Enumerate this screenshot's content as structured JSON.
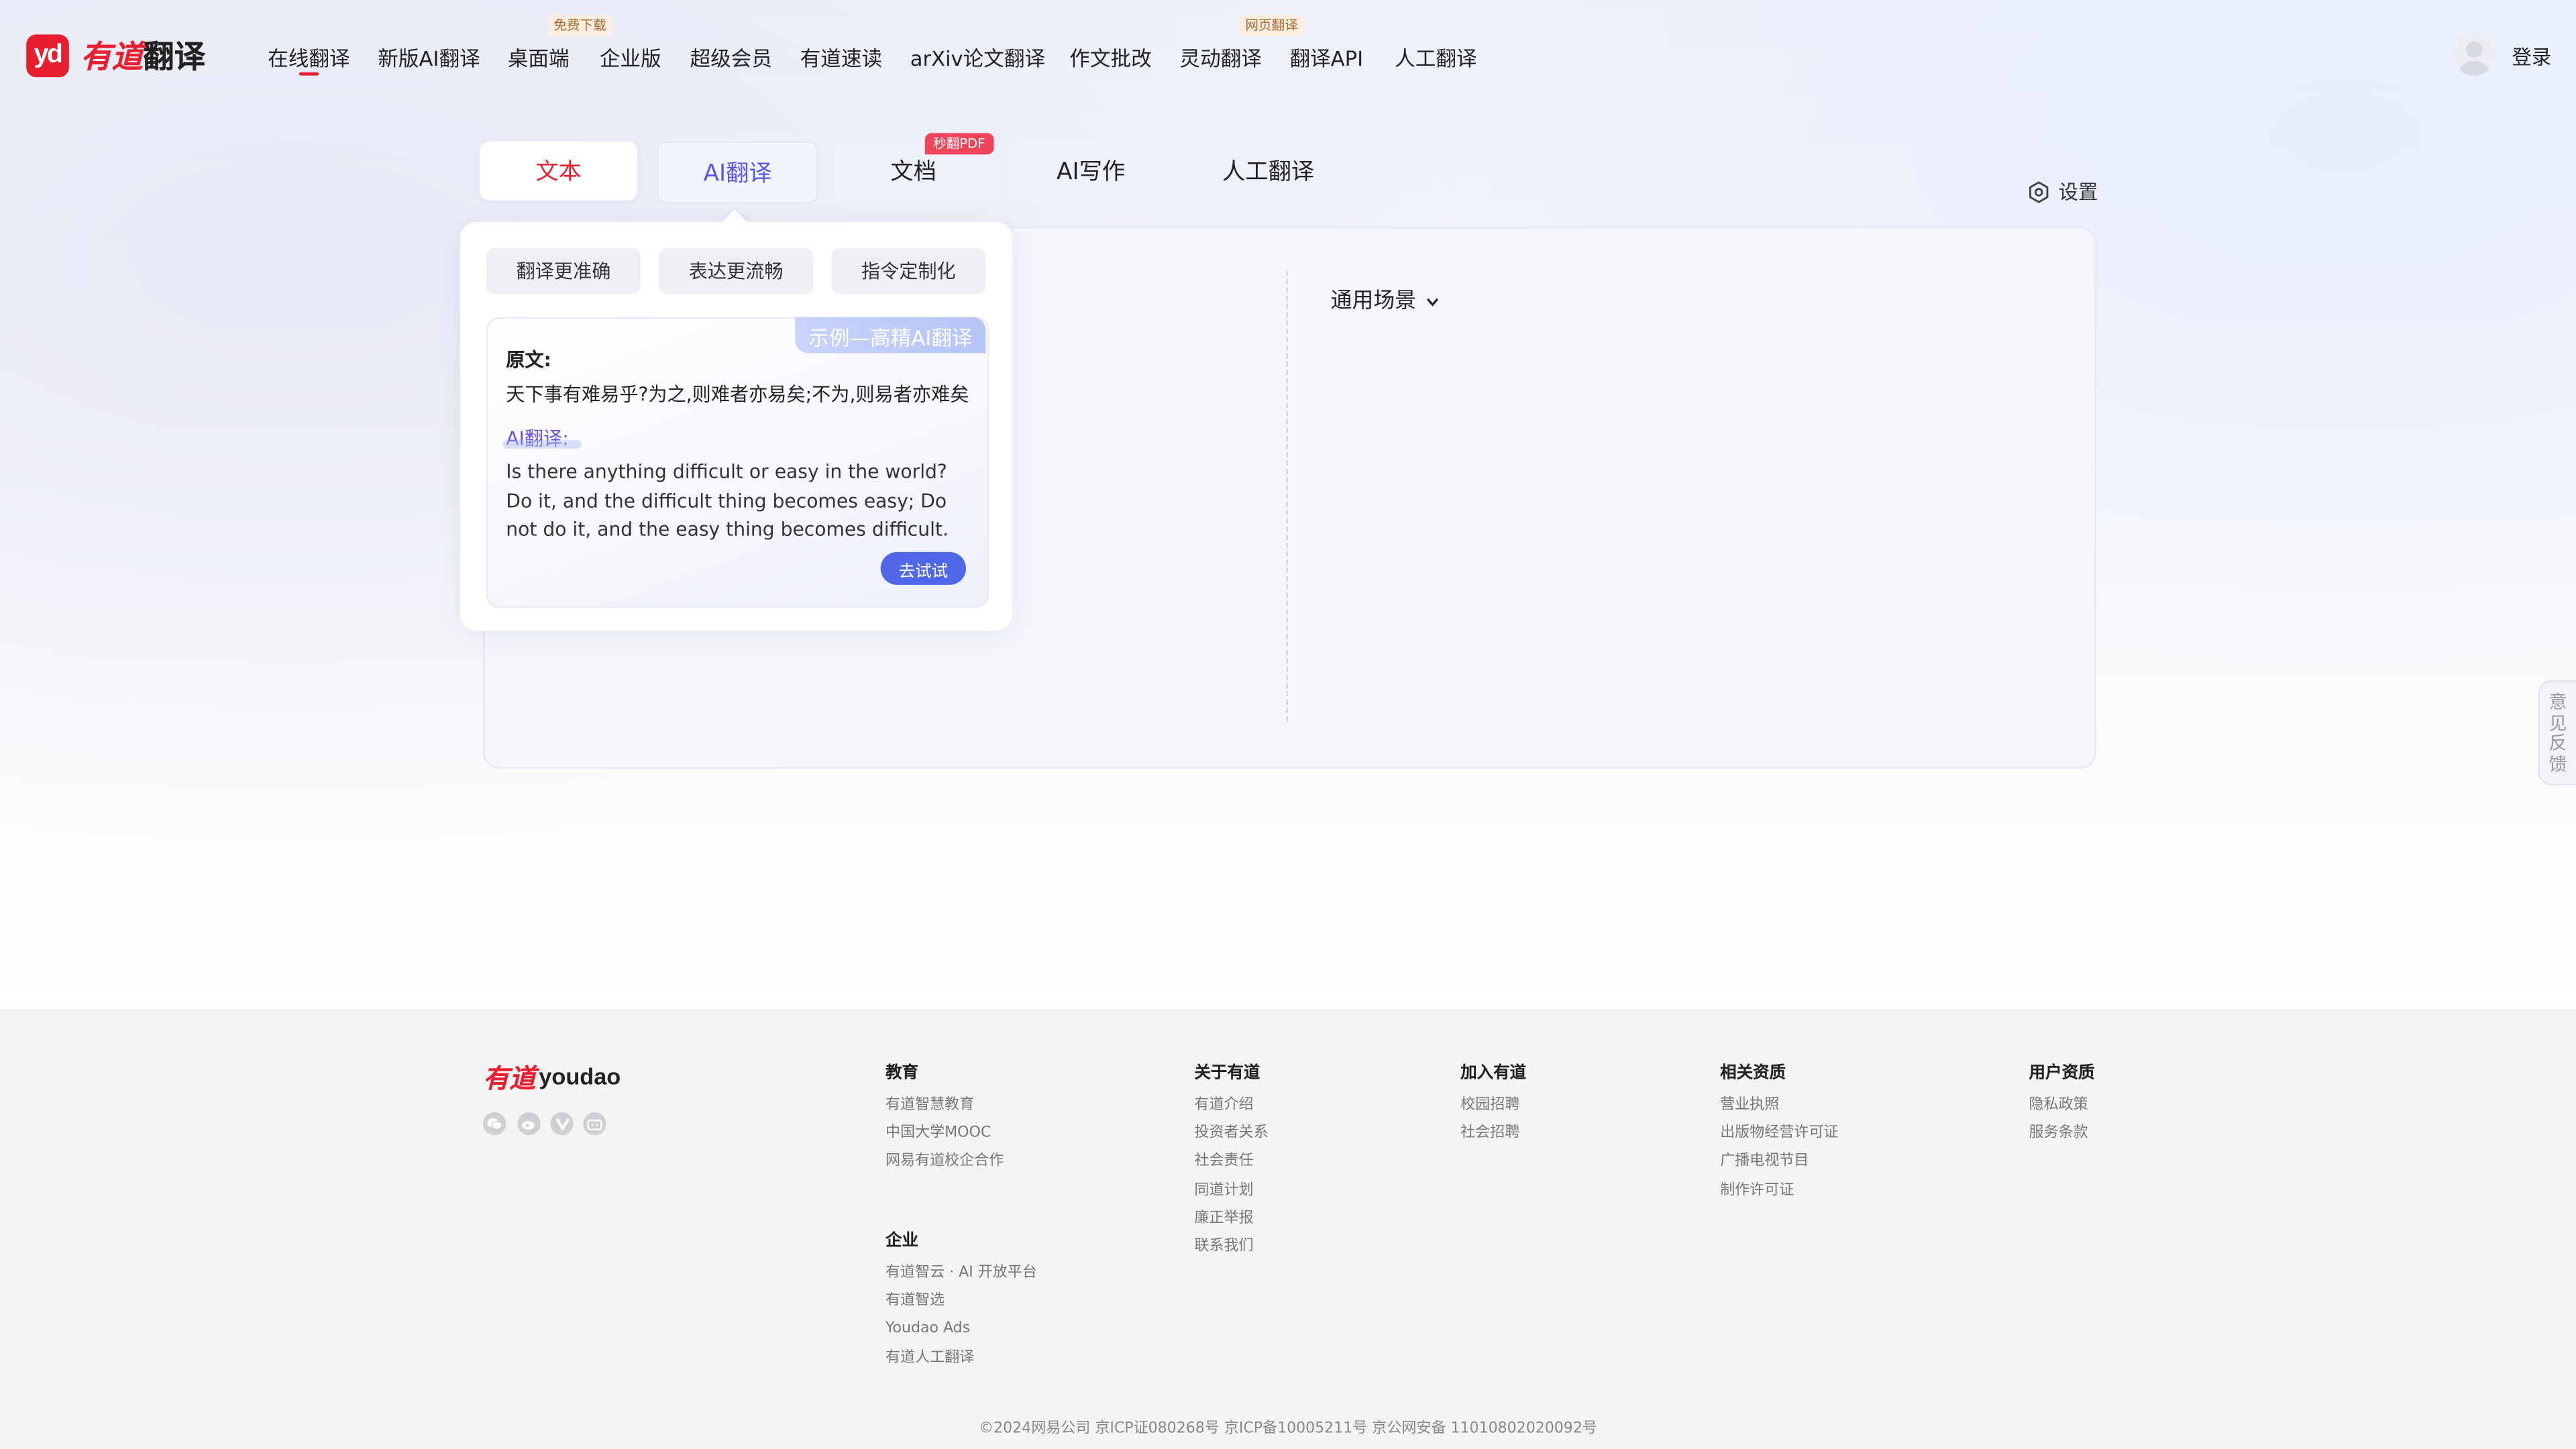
{
  "brand": {
    "logo_mark": "yd",
    "name_red": "有道",
    "name_dark": "翻译",
    "accent_color": "#e81f2e"
  },
  "nav": {
    "items": [
      {
        "label": "在线翻译"
      },
      {
        "label": "新版AI翻译"
      },
      {
        "label": "桌面端",
        "tag": "免费下载"
      },
      {
        "label": "企业版"
      },
      {
        "label": "超级会员"
      },
      {
        "label": "有道速读"
      },
      {
        "label": "arXiv论文翻译"
      },
      {
        "label": "作文批改"
      },
      {
        "label": "灵动翻译",
        "tag": "网页翻译"
      },
      {
        "label": "翻译API"
      },
      {
        "label": "人工翻译"
      }
    ],
    "active": "在线翻译",
    "login": "登录"
  },
  "tabs": [
    {
      "label": "文本"
    },
    {
      "label": "AI翻译"
    },
    {
      "label": "文档",
      "badge": "秒翻PDF"
    },
    {
      "label": "AI写作"
    },
    {
      "label": "人工翻译"
    }
  ],
  "settings_label": "设置",
  "scene_label": "通用场景",
  "popover": {
    "features": [
      "翻译更准确",
      "表达更流畅",
      "指令定制化"
    ],
    "example_tag": "示例—高精AI翻译",
    "source_label": "原文:",
    "source_text": "天下事有难易乎?为之,则难者亦易矣;不为,则易者亦难矣",
    "ai_label": "AI翻译:",
    "ai_text": "Is there anything difficult or easy in the world? Do it, and the difficult thing becomes easy; Do not do it, and the easy thing becomes difficult.",
    "try_button": "去试试"
  },
  "feedback": [
    "意",
    "见",
    "反",
    "馈"
  ],
  "footer": {
    "logo_red": "有道",
    "logo_text": "youdao",
    "social_icons": [
      "wechat-icon",
      "weibo-icon",
      "v-icon",
      "bilibili-icon"
    ],
    "columns": [
      {
        "title": "教育",
        "links": [
          "有道智慧教育",
          "中国大学MOOC",
          "网易有道校企合作"
        ]
      },
      {
        "title": "企业",
        "links": [
          "有道智云 · AI 开放平台",
          "有道智选",
          "Youdao Ads",
          "有道人工翻译"
        ]
      },
      {
        "title": "关于有道",
        "links": [
          "有道介绍",
          "投资者关系",
          "社会责任",
          "同道计划",
          "廉正举报",
          "联系我们"
        ]
      },
      {
        "title": "加入有道",
        "links": [
          "校园招聘",
          "社会招聘"
        ]
      },
      {
        "title": "相关资质",
        "links": [
          "营业执照",
          "出版物经营许可证",
          "广播电视节目",
          "制作许可证"
        ]
      },
      {
        "title": "用户资质",
        "links": [
          "隐私政策",
          "服务条款"
        ]
      }
    ],
    "copyright": "©2024网易公司 京ICP证080268号 京ICP备10005211号 京公网安备 11010802020092号"
  }
}
